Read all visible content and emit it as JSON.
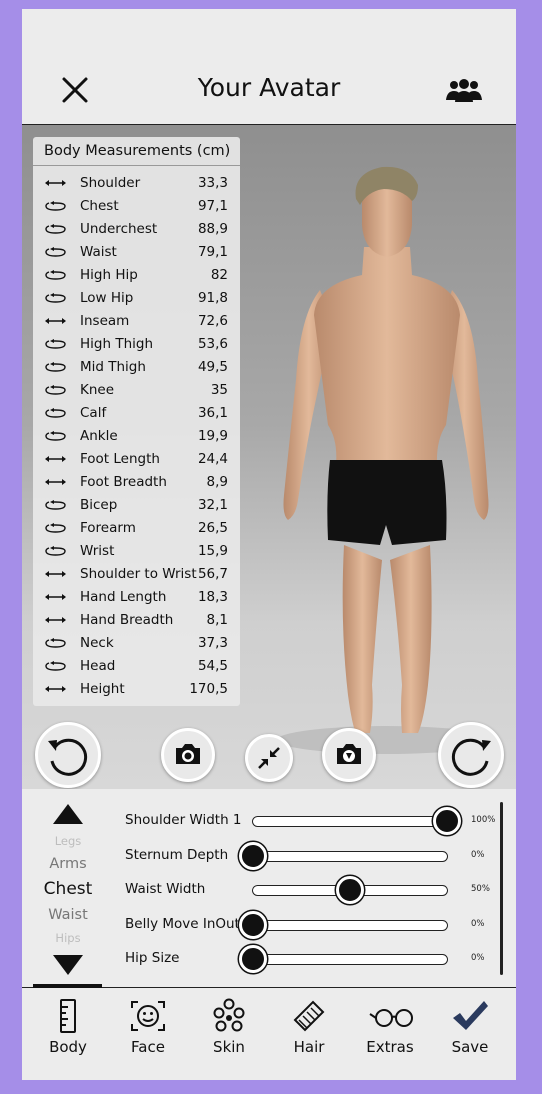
{
  "header": {
    "title": "Your Avatar",
    "close_icon": "close-icon",
    "people_icon": "group-icon"
  },
  "measurements": {
    "title": "Body Measurements (cm)",
    "items": [
      {
        "icon": "length",
        "label": "Shoulder",
        "value": "33,3"
      },
      {
        "icon": "circumference",
        "label": "Chest",
        "value": "97,1"
      },
      {
        "icon": "circumference",
        "label": "Underchest",
        "value": "88,9"
      },
      {
        "icon": "circumference",
        "label": "Waist",
        "value": "79,1"
      },
      {
        "icon": "circumference",
        "label": "High Hip",
        "value": "82"
      },
      {
        "icon": "circumference",
        "label": "Low Hip",
        "value": "91,8"
      },
      {
        "icon": "length",
        "label": "Inseam",
        "value": "72,6"
      },
      {
        "icon": "circumference",
        "label": "High Thigh",
        "value": "53,6"
      },
      {
        "icon": "circumference",
        "label": "Mid Thigh",
        "value": "49,5"
      },
      {
        "icon": "circumference",
        "label": "Knee",
        "value": "35"
      },
      {
        "icon": "circumference",
        "label": "Calf",
        "value": "36,1"
      },
      {
        "icon": "circumference",
        "label": "Ankle",
        "value": "19,9"
      },
      {
        "icon": "length",
        "label": "Foot Length",
        "value": "24,4"
      },
      {
        "icon": "length",
        "label": "Foot Breadth",
        "value": "8,9"
      },
      {
        "icon": "circumference",
        "label": "Bicep",
        "value": "32,1"
      },
      {
        "icon": "circumference",
        "label": "Forearm",
        "value": "26,5"
      },
      {
        "icon": "circumference",
        "label": "Wrist",
        "value": "15,9"
      },
      {
        "icon": "length",
        "label": "Shoulder to Wrist",
        "value": "56,7"
      },
      {
        "icon": "length",
        "label": "Hand Length",
        "value": "18,3"
      },
      {
        "icon": "length",
        "label": "Hand Breadth",
        "value": "8,1"
      },
      {
        "icon": "circumference",
        "label": "Neck",
        "value": "37,3"
      },
      {
        "icon": "circumference",
        "label": "Head",
        "value": "54,5"
      },
      {
        "icon": "length",
        "label": "Height",
        "value": "170,5"
      }
    ]
  },
  "viewer_controls": [
    "rotate-left-icon",
    "camera-icon",
    "shrink-icon",
    "camera-download-icon",
    "rotate-right-icon"
  ],
  "categories": {
    "items": [
      "Legs",
      "Arms",
      "Chest",
      "Waist",
      "Hips"
    ],
    "selected": "Chest"
  },
  "sliders": [
    {
      "label": "Shoulder Width 1",
      "value": 1.0,
      "display": "100%"
    },
    {
      "label": "Sternum Depth",
      "value": 0.0,
      "display": "0%"
    },
    {
      "label": "Waist Width",
      "value": 0.5,
      "display": "50%"
    },
    {
      "label": "Belly Move InOut",
      "value": 0.0,
      "display": "0%"
    },
    {
      "label": "Hip Size",
      "value": 0.0,
      "display": "0%"
    }
  ],
  "nav": {
    "selected": "Body",
    "items": [
      {
        "label": "Body",
        "icon": "ruler-icon"
      },
      {
        "label": "Face",
        "icon": "face-icon"
      },
      {
        "label": "Skin",
        "icon": "skin-tone-icon"
      },
      {
        "label": "Hair",
        "icon": "comb-icon"
      },
      {
        "label": "Extras",
        "icon": "glasses-icon"
      },
      {
        "label": "Save",
        "icon": "checkmark-icon"
      }
    ]
  },
  "colors": {
    "frame": "#a58ee8",
    "save_check": "#2a3a5e"
  }
}
